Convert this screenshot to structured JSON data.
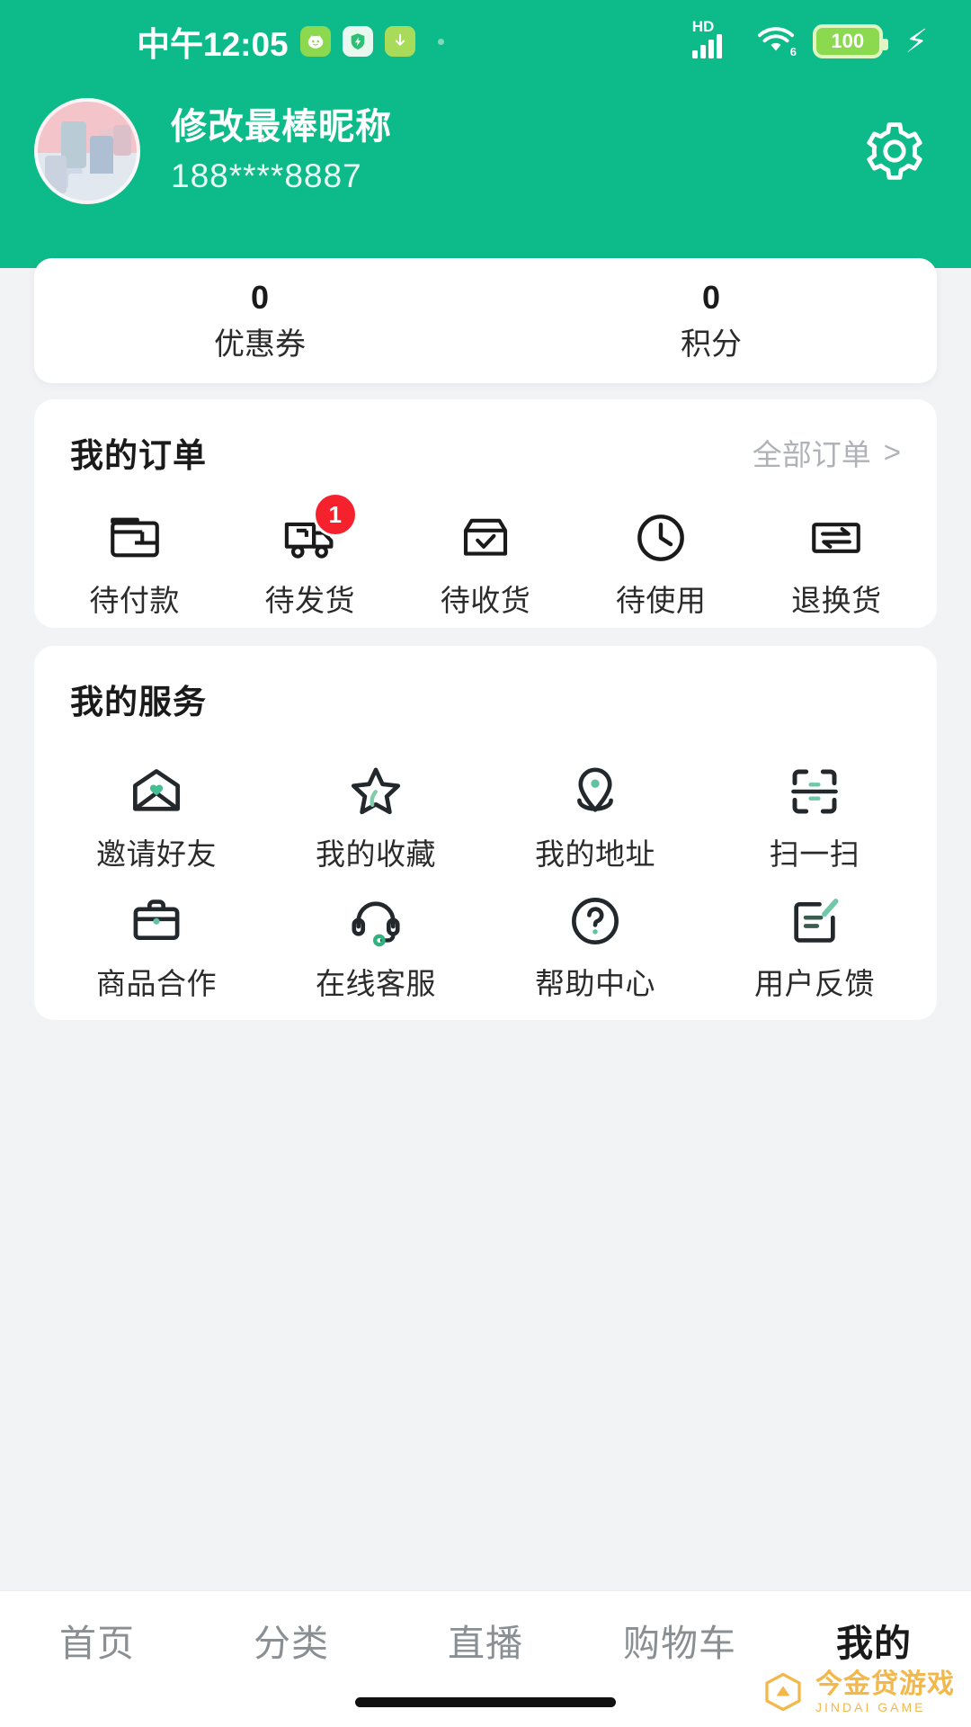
{
  "status_bar": {
    "time": "中午12:05",
    "chips": [
      "smiley-chip",
      "shield-chip",
      "download-chip"
    ],
    "hd_label": "HD",
    "wifi_gen": "6",
    "battery_level": "100",
    "charging": true
  },
  "profile": {
    "nickname": "修改最棒昵称",
    "phone": "188****8887",
    "settings_icon": "gear-icon"
  },
  "stats": [
    {
      "value": "0",
      "label": "优惠券"
    },
    {
      "value": "0",
      "label": "积分"
    }
  ],
  "orders": {
    "title": "我的订单",
    "more_label": "全部订单",
    "more_chevron": ">",
    "items": [
      {
        "label": "待付款",
        "icon": "wallet-icon",
        "badge": ""
      },
      {
        "label": "待发货",
        "icon": "truck-icon",
        "badge": "1"
      },
      {
        "label": "待收货",
        "icon": "box-check-icon",
        "badge": ""
      },
      {
        "label": "待使用",
        "icon": "clock-icon",
        "badge": ""
      },
      {
        "label": "退换货",
        "icon": "exchange-icon",
        "badge": ""
      }
    ]
  },
  "services": {
    "title": "我的服务",
    "items": [
      {
        "label": "邀请好友",
        "icon": "envelope-heart-icon"
      },
      {
        "label": "我的收藏",
        "icon": "star-icon"
      },
      {
        "label": "我的地址",
        "icon": "location-pin-icon"
      },
      {
        "label": "扫一扫",
        "icon": "scan-qr-icon"
      },
      {
        "label": "商品合作",
        "icon": "briefcase-icon"
      },
      {
        "label": "在线客服",
        "icon": "headset-icon"
      },
      {
        "label": "帮助中心",
        "icon": "question-circle-icon"
      },
      {
        "label": "用户反馈",
        "icon": "feedback-edit-icon"
      }
    ]
  },
  "tabbar": {
    "items": [
      {
        "label": "首页",
        "active": false
      },
      {
        "label": "分类",
        "active": false
      },
      {
        "label": "直播",
        "active": false
      },
      {
        "label": "购物车",
        "active": false
      },
      {
        "label": "我的",
        "active": true
      }
    ]
  },
  "watermark": {
    "main": "今金贷游戏",
    "sub": "JINDAI GAME"
  },
  "colors": {
    "brand_green": "#0DBB8A",
    "page_bg": "#F2F3F5",
    "card_bg": "#FFFFFF",
    "badge_red": "#F5222D",
    "icon_accent": "#3FBF8F",
    "muted_text": "#AFB3B8",
    "watermark": "#F2B33C"
  }
}
